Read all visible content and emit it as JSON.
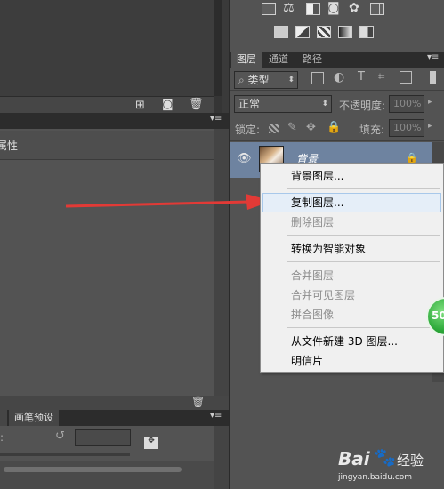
{
  "layers_panel": {
    "tabs": [
      "图层",
      "通道",
      "路径"
    ],
    "filter_label": "类型",
    "blend_mode": "正常",
    "opacity_label": "不透明度:",
    "opacity_value": "100%",
    "lock_label": "锁定:",
    "fill_label": "填充:",
    "fill_value": "100%",
    "layer_name": "背景"
  },
  "left_panel": {
    "properties_label": "属性",
    "bottom_tab": "画笔预设"
  },
  "context_menu": {
    "items": [
      {
        "label": "背景图层...",
        "disabled": false
      },
      {
        "label": "复制图层...",
        "disabled": false,
        "highlighted": true
      },
      {
        "label": "删除图层",
        "disabled": true
      },
      {
        "label": "转换为智能对象",
        "disabled": false
      },
      {
        "label": "合并图层",
        "disabled": true
      },
      {
        "label": "合并可见图层",
        "disabled": true
      },
      {
        "label": "拼合图像",
        "disabled": true
      },
      {
        "label": "从文件新建 3D 图层...",
        "disabled": false
      },
      {
        "label": "明信片",
        "disabled": false
      }
    ]
  },
  "badge": {
    "text": "50"
  },
  "watermark": {
    "brand": "Bai",
    "suffix": "经验",
    "url": "jingyan.baidu.com"
  },
  "colors": {
    "panel_bg": "#535353",
    "menu_bg": "#f0f0f0",
    "arrow": "#e23a36",
    "badge": "#2da93a"
  }
}
